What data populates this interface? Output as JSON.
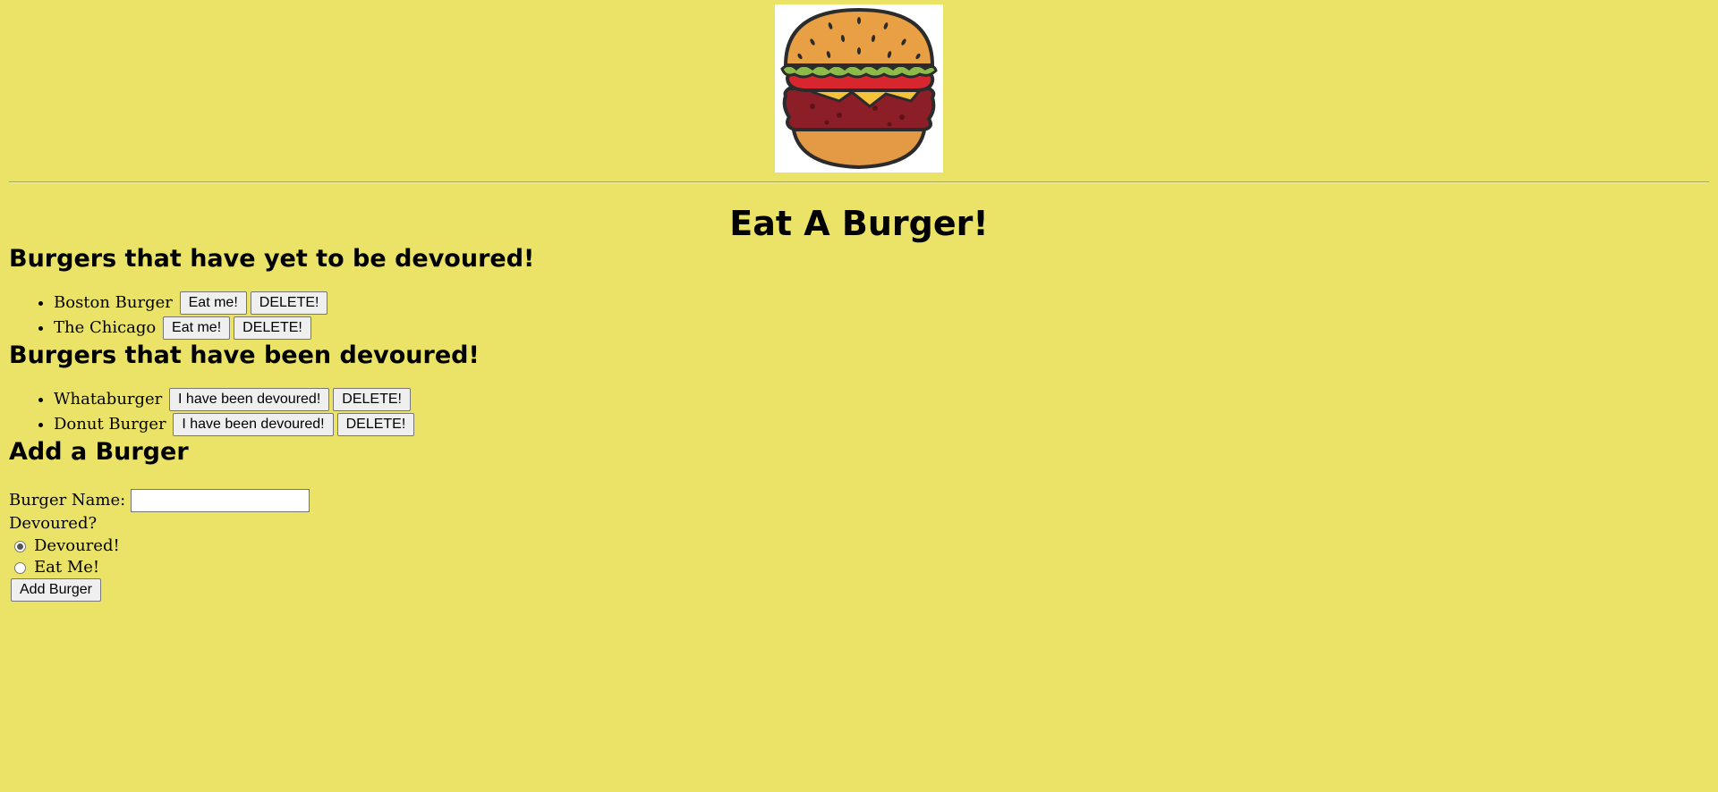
{
  "header": {
    "logo_icon": "burger-icon",
    "title": "Eat A Burger!"
  },
  "uneaten": {
    "heading": "Burgers that have yet to be devoured!",
    "items": [
      {
        "name": "Boston Burger",
        "action_label": "Eat me!",
        "delete_label": "DELETE!"
      },
      {
        "name": "The Chicago",
        "action_label": "Eat me!",
        "delete_label": "DELETE!"
      }
    ]
  },
  "eaten": {
    "heading": "Burgers that have been devoured!",
    "items": [
      {
        "name": "Whataburger",
        "action_label": "I have been devoured!",
        "delete_label": "DELETE!"
      },
      {
        "name": "Donut Burger",
        "action_label": "I have been devoured!",
        "delete_label": "DELETE!"
      }
    ]
  },
  "add_form": {
    "heading": "Add a Burger",
    "name_label": "Burger Name:",
    "name_value": "",
    "devoured_label": "Devoured?",
    "options": [
      {
        "label": "Devoured!",
        "checked": true
      },
      {
        "label": "Eat Me!",
        "checked": false
      }
    ],
    "submit_label": "Add Burger"
  },
  "colors": {
    "background": "#ebe367"
  }
}
